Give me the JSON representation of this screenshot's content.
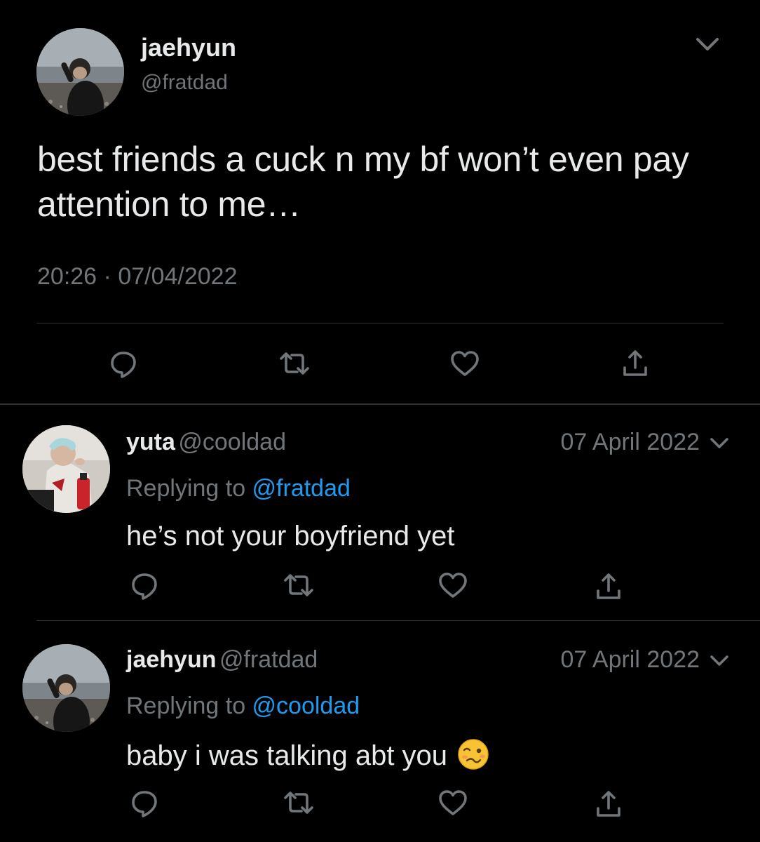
{
  "main_tweet": {
    "display_name": "jaehyun",
    "handle": "@fratdad",
    "text": "best friends a cuck n my bf won’t even pay attention to me…",
    "time": "20:26",
    "separator": "·",
    "date": "07/04/2022",
    "avatar": "profile-photo-beach"
  },
  "replies": [
    {
      "display_name": "yuta",
      "handle": "@cooldad",
      "date": "07 April 2022",
      "replying_prefix": "Replying to ",
      "replying_to": "@fratdad",
      "text": "he’s not your boyfriend yet",
      "avatar": "profile-photo-blonde"
    },
    {
      "display_name": "jaehyun",
      "handle": "@fratdad",
      "date": "07 April 2022",
      "replying_prefix": "Replying to ",
      "replying_to": "@cooldad",
      "text": "baby i was talking abt you",
      "emoji": "woozy-face",
      "avatar": "profile-photo-beach"
    }
  ],
  "actions": [
    "reply-icon",
    "retweet-icon",
    "like-icon",
    "share-icon"
  ],
  "colors": {
    "background": "#000000",
    "primary_text": "#e7e9ea",
    "secondary_text": "#71767b",
    "link": "#1d9bf0",
    "divider": "#2f3336"
  }
}
